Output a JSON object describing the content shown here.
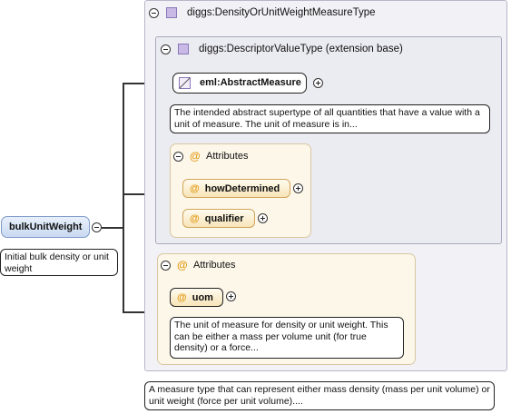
{
  "root": {
    "element_name": "bulkUnitWeight",
    "doc": "Initial bulk density or unit weight"
  },
  "outer_type": {
    "name": "diggs:DensityOrUnitWeightMeasureType",
    "doc": "A measure type that can represent either mass density (mass per unit volume) or unit weight (force per unit volume)...."
  },
  "inner_type": {
    "name": "diggs:DescriptorValueType (extension base)"
  },
  "abstract_measure": {
    "name": "eml:AbstractMeasure",
    "doc": "The intended abstract supertype of all quantities that have a value with a unit of measure. The unit of measure is in..."
  },
  "inner_attributes": {
    "title": "Attributes",
    "items": [
      {
        "label": "howDetermined"
      },
      {
        "label": "qualifier"
      }
    ]
  },
  "outer_attributes": {
    "title": "Attributes",
    "uom": {
      "label": "uom",
      "doc": "The unit of measure for density or unit weight. This can be either a mass per volume unit (for true density) or a force..."
    }
  },
  "icons": {
    "type_icon": "complex-type-icon",
    "abstract_icon": "abstract-element-icon",
    "attribute_icon": "at-sign-icon",
    "collapse_icon": "collapse-minus-icon",
    "expand_icon": "expand-plus-icon"
  },
  "colors": {
    "attribute_accent": "#e39a14",
    "type_icon": "#c9b9e7",
    "root_element": "#c9d9f1"
  }
}
